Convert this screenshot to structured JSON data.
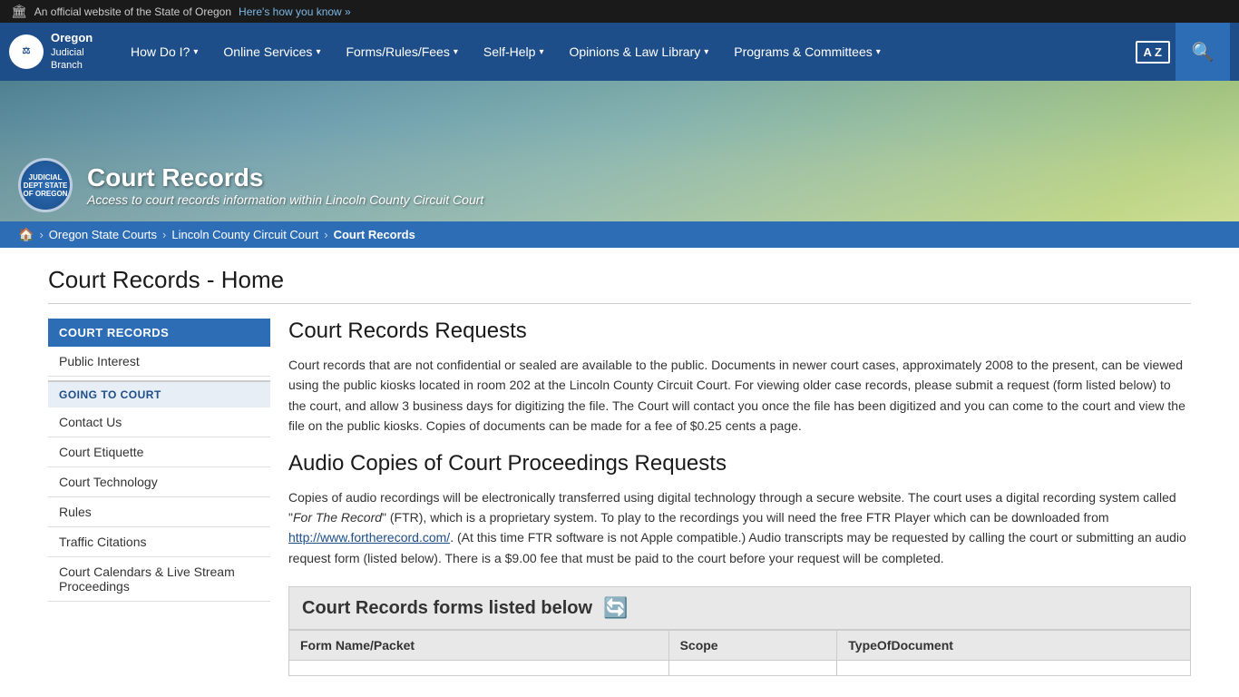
{
  "topBanner": {
    "flag": "🏛",
    "text": "An official website of the State of Oregon",
    "linkText": "Here's how you know »"
  },
  "nav": {
    "logo": {
      "line1": "Oregon",
      "line2": "Judicial",
      "line3": "Branch"
    },
    "items": [
      {
        "label": "How Do I?",
        "hasDropdown": true
      },
      {
        "label": "Online Services",
        "hasDropdown": true
      },
      {
        "label": "Forms/Rules/Fees",
        "hasDropdown": true
      },
      {
        "label": "Self-Help",
        "hasDropdown": true
      },
      {
        "label": "Opinions & Law Library",
        "hasDropdown": true
      },
      {
        "label": "Programs & Committees",
        "hasDropdown": true
      }
    ],
    "langButton": "A Z",
    "searchIcon": "🔍"
  },
  "hero": {
    "sealText": "JUDICIAL DEPT STATE OF OREGON",
    "title": "Court Records",
    "subtitle": "Access to court records information within Lincoln County Circuit Court"
  },
  "breadcrumb": {
    "homeIcon": "🏠",
    "items": [
      {
        "label": "Oregon State Courts",
        "isCurrent": false
      },
      {
        "label": "Lincoln County Circuit Court",
        "isCurrent": false
      },
      {
        "label": "Court Records",
        "isCurrent": true
      }
    ]
  },
  "pageTitle": "Court Records - Home",
  "sidebar": {
    "sections": [
      {
        "title": "COURT RECORDS",
        "type": "header",
        "isActive": true
      },
      {
        "type": "item",
        "label": "Public Interest"
      },
      {
        "title": "GOING TO COURT",
        "type": "subheader"
      },
      {
        "type": "item",
        "label": "Contact Us"
      },
      {
        "type": "item",
        "label": "Court Etiquette"
      },
      {
        "type": "item",
        "label": "Court Technology"
      },
      {
        "type": "item",
        "label": "Rules"
      },
      {
        "type": "item",
        "label": "Traffic Citations"
      },
      {
        "type": "item",
        "label": "Court Calendars & Live Stream Proceedings"
      }
    ]
  },
  "mainContent": {
    "sections": [
      {
        "heading": "Court Records Requests",
        "paragraphs": [
          "Court records that are not confidential or sealed are available to the public.  Documents in newer court cases, approximately 2008 to the present, can be viewed using the public kiosks located in room 202 at the Lincoln County Circuit Court.  For viewing older case records, please submit a request (form listed below)  to the court, and allow 3 business days for digitizing the file.  The Court will contact you once the file has been digitized and you can come to the court and view the file on the public kiosks.  Copies of documents can be made for a fee of $0.25 cents a page."
        ]
      },
      {
        "heading": "Audio Copies of Court Proceedings Requests",
        "paragraphs": [
          "Copies of audio recordings will be electronically transferred using digital technology through a secure website. The court uses a digital recording system called \"For The Record\" (FTR), which is a proprietary system. To play to the recordings you will need the free FTR Player which can be downloaded from http://www.fortherecord.com/.  (At this time FTR software is not Apple compatible.)  Audio transcripts may be requested by calling the court or submitting an audio request form (listed below).  There is a $9.00 fee that must be paid to the court before your request will be completed."
        ]
      }
    ],
    "formsSection": {
      "heading": "Court Records forms listed below",
      "tableHeaders": [
        "Form Name/Packet",
        "Scope",
        "TypeOfDocument"
      ]
    }
  }
}
